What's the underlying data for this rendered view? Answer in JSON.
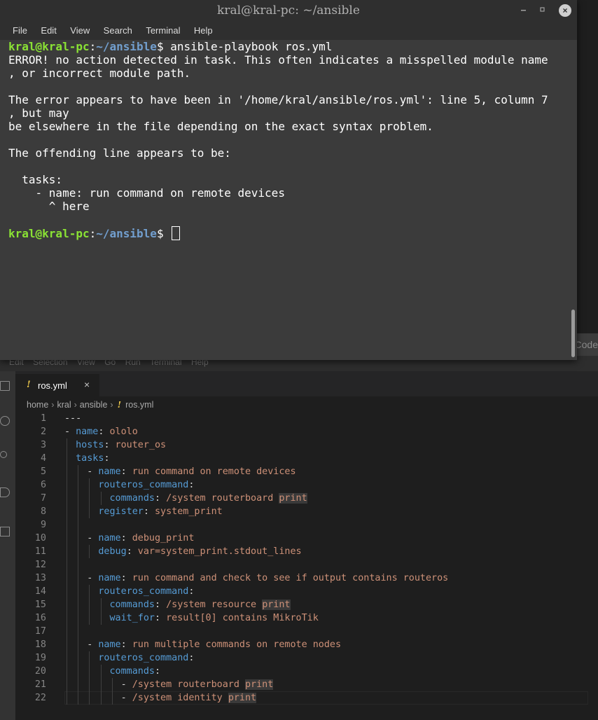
{
  "terminal": {
    "title": "kral@kral-pc: ~/ansible",
    "menu": [
      "File",
      "Edit",
      "View",
      "Search",
      "Terminal",
      "Help"
    ],
    "prompt_user": "kral@kral-pc",
    "prompt_colon": ":",
    "prompt_path": "~/ansible",
    "prompt_dollar": "$ ",
    "command": "ansible-playbook ros.yml",
    "output": [
      "ERROR! no action detected in task. This often indicates a misspelled module name",
      ", or incorrect module path.",
      "",
      "The error appears to have been in '/home/kral/ansible/ros.yml': line 5, column 7",
      ", but may",
      "be elsewhere in the file depending on the exact syntax problem.",
      "",
      "The offending line appears to be:",
      "",
      "  tasks:",
      "    - name: run command on remote devices",
      "      ^ here"
    ],
    "minimize_icon": "minimize-icon",
    "maximize_icon": "maximize-icon",
    "close_icon": "close-icon",
    "close_glyph": "×"
  },
  "vscode": {
    "title": "ros.yml - Visual Studio Code",
    "menu": [
      "Edit",
      "Selection",
      "View",
      "Go",
      "Run",
      "Terminal",
      "Help"
    ],
    "tab": {
      "label": "ros.yml",
      "icon": "!",
      "close": "×"
    },
    "breadcrumbs": [
      "home",
      "kral",
      "ansible",
      "ros.yml"
    ],
    "breadcrumb_sep": "›",
    "yaml_icon": "!",
    "lines": [
      "---",
      "- name: ololo",
      "  hosts: router_os",
      "  tasks:",
      "    - name: run command on remote devices",
      "      routeros_command:",
      "        commands: /system routerboard print",
      "      register: system_print",
      "",
      "    - name: debug_print",
      "      debug: var=system_print.stdout_lines",
      "",
      "    - name: run command and check to see if output contains routeros",
      "      routeros_command:",
      "        commands: /system resource print",
      "        wait_for: result[0] contains MikroTik",
      "",
      "    - name: run multiple commands on remote nodes",
      "      routeros_command:",
      "        commands:",
      "          - /system routerboard print",
      "          - /system identity print"
    ],
    "colors": {
      "key": "#569cd6",
      "value": "#ce9178",
      "punct": "#d4d4d4",
      "line_number": "#858585"
    }
  }
}
